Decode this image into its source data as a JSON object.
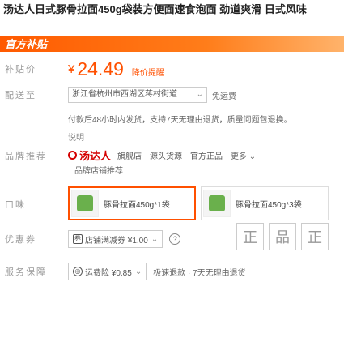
{
  "product": {
    "title": "汤达人日式豚骨拉面450g袋装方便面速食泡面 劲道爽滑 日式风味",
    "promo_banner": "官方补贴"
  },
  "price": {
    "label": "补贴价",
    "currency": "¥",
    "amount": "24.49",
    "tip": "降价提醒"
  },
  "shipping": {
    "label": "配送至",
    "select_value": "浙江省杭州市西湖区蒋村街道",
    "fee": "免运费"
  },
  "notice": {
    "line1": "付款后48小时内发货，支持7天无理由退货，质量问题包退换。",
    "line2": "说明"
  },
  "brand": {
    "label": "品牌推荐",
    "name": "汤达人",
    "chips": [
      "旗舰店",
      "源头货源",
      "官方正品"
    ],
    "more": "更多",
    "sub": "品牌店铺推荐"
  },
  "sku": {
    "label": "口味",
    "options": [
      {
        "text": "豚骨拉面450g*1袋",
        "selected": true
      },
      {
        "text": "豚骨拉面450g*3袋",
        "selected": false
      }
    ]
  },
  "coupon": {
    "label": "优惠券",
    "text": "店铺满减券 ¥1.00",
    "help": "?"
  },
  "service": {
    "label": "服务保障",
    "text": "运费险 ¥0.85",
    "more": "极速退款 · 7天无理由退货"
  },
  "tags": [
    "正",
    "品",
    "正"
  ]
}
